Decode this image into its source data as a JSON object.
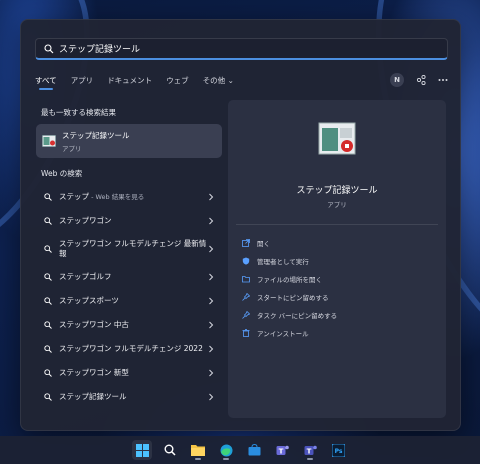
{
  "search": {
    "value": "ステップ記録ツール"
  },
  "filters": {
    "tabs": [
      "すべて",
      "アプリ",
      "ドキュメント",
      "ウェブ",
      "その他"
    ],
    "active": "すべて",
    "avatar_initial": "N"
  },
  "best_match": {
    "section_title": "最も一致する検索結果",
    "title": "ステップ記録ツール",
    "subtitle": "アプリ"
  },
  "web": {
    "section_title": "Web の検索",
    "items": [
      {
        "label": "ステップ",
        "sub": " - Web 結果を見る"
      },
      {
        "label": "ステップワゴン",
        "sub": ""
      },
      {
        "label": "ステップワゴン フルモデルチェンジ 最新情報",
        "sub": ""
      },
      {
        "label": "ステップゴルフ",
        "sub": ""
      },
      {
        "label": "ステップスポーツ",
        "sub": ""
      },
      {
        "label": "ステップワゴン 中古",
        "sub": ""
      },
      {
        "label": "ステップワゴン フルモデルチェンジ 2022",
        "sub": ""
      },
      {
        "label": "ステップワゴン 新型",
        "sub": ""
      },
      {
        "label": "ステップ記録ツール",
        "sub": ""
      }
    ]
  },
  "detail": {
    "title": "ステップ記録ツール",
    "kind": "アプリ",
    "actions": [
      "開く",
      "管理者として実行",
      "ファイルの場所を開く",
      "スタートにピン留めする",
      "タスク バーにピン留めする",
      "アンインストール"
    ]
  },
  "colors": {
    "accent": "#4c8fe0",
    "panel": "#202434",
    "selected": "#3a3f52"
  },
  "taskbar": {
    "icons": [
      "windows-start-icon",
      "search-icon",
      "file-explorer-icon",
      "edge-icon",
      "store-icon",
      "teams-icon",
      "teams-work-icon",
      "photoshop-icon"
    ]
  }
}
